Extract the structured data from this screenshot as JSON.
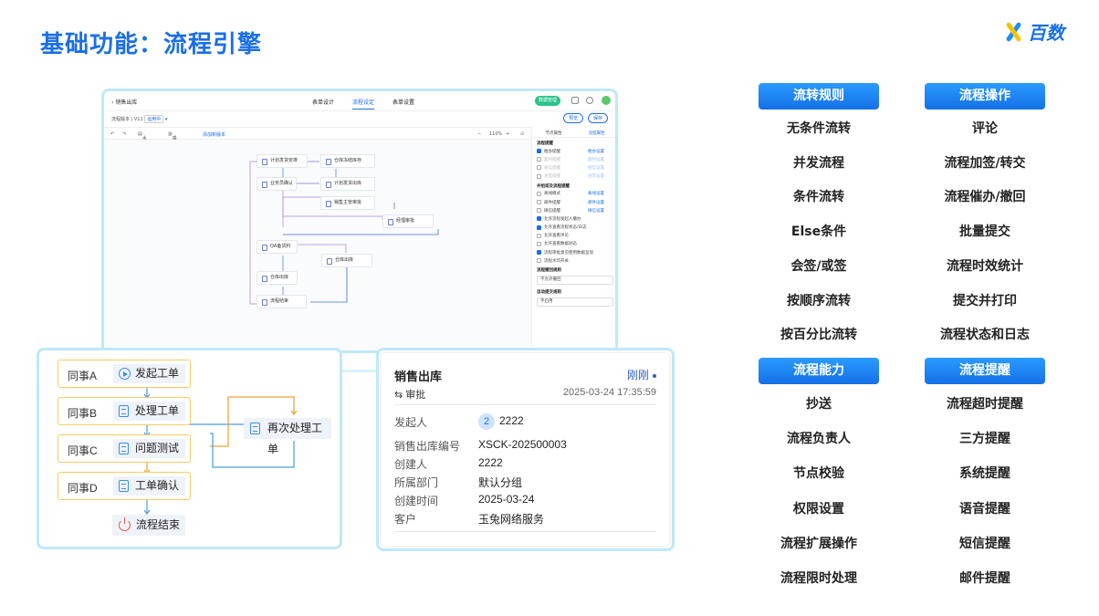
{
  "title": "基础功能：流程引擎",
  "logo_text": "百数",
  "screenshot": {
    "back_label": "销售出库",
    "tabs": [
      "表单设计",
      "流程设定",
      "表单设置"
    ],
    "active_tab": 1,
    "publish_label": "数据管理",
    "version_label": "流程版本 | V11",
    "version_tag": "运用中",
    "preview_label": "预览",
    "save_label": "保存",
    "toolbar": {
      "undo": "↶",
      "redo": "↷",
      "horizontal": "水平画面",
      "vertical": "垂直画面",
      "add_version": "添加新版本",
      "zoom": "110%"
    },
    "nodes": [
      "计划发货安排",
      "仓库冻结库存",
      "业务员确认",
      "计划发货出库",
      "销售主管审批",
      "经理审批",
      "QA备货料",
      "仓库出库",
      "仓库出库",
      "流程结束"
    ],
    "side_tabs": [
      "节点属性",
      "流程属性"
    ],
    "side_active": 1,
    "side": {
      "sec1": "流程提醒",
      "rows1": [
        {
          "label": "催办提醒",
          "link": "催办设置",
          "on": true
        },
        {
          "label": "超时提醒",
          "link": "超时设置",
          "on": false
        },
        {
          "label": "短信提醒",
          "link": "短信设置",
          "on": false
        },
        {
          "label": "语音提醒",
          "link": "语音设置",
          "on": false
        }
      ],
      "sec2": "并组或及流程提醒",
      "rows2": [
        {
          "label": "离线模式",
          "link": "离线设置",
          "on": false
        },
        {
          "label": "邮件提醒",
          "link": "邮件设置",
          "on": false
        },
        {
          "label": "微信提醒",
          "link": "微信设置",
          "on": false
        },
        {
          "label": "允许流程发起人撤办",
          "link": "",
          "on": true
        },
        {
          "label": "允许查看流程状态/日志",
          "link": "",
          "on": true
        },
        {
          "label": "允许查看评论",
          "link": "",
          "on": false
        },
        {
          "label": "允许查看数据动态",
          "link": "",
          "on": false
        },
        {
          "label": "流程审批意见使用数据呈现",
          "link": "",
          "on": true
        },
        {
          "label": "流程水印开关",
          "link": "",
          "on": false
        }
      ],
      "sec3": "流程撤回规则",
      "sel3": "不允许撤回",
      "sec4": "自动提交规则",
      "sel4": "不启用"
    }
  },
  "flow": {
    "rows": [
      {
        "who": "同事A",
        "action": "发起工单",
        "icon": "play-icon"
      },
      {
        "who": "同事B",
        "action": "处理工单",
        "icon": "doc-icon"
      },
      {
        "who": "同事C",
        "action": "问题测试",
        "icon": "doc-icon"
      },
      {
        "who": "同事D",
        "action": "工单确认",
        "icon": "doc-icon"
      }
    ],
    "redo": "再次处理工单",
    "end": "流程结束"
  },
  "detail": {
    "title": "销售出库",
    "time_label": "刚刚",
    "sub": "审批",
    "date": "2025-03-24 17:35:59",
    "fields": [
      {
        "k": "发起人",
        "v": "2222",
        "badge": "2"
      },
      {
        "k": "销售出库编号",
        "v": "XSCK-202500003"
      },
      {
        "k": "创建人",
        "v": "2222"
      },
      {
        "k": "所属部门",
        "v": "默认分组"
      },
      {
        "k": "创建时间",
        "v": "2025-03-24"
      },
      {
        "k": "客户",
        "v": "玉兔网络服务"
      }
    ]
  },
  "features": {
    "col1_top": {
      "title": "流转规则",
      "items": [
        "无条件流转",
        "并发流程",
        "条件流转",
        "Else条件",
        "会签/或签",
        "按顺序流转",
        "按百分比流转"
      ]
    },
    "col2_top": {
      "title": "流程操作",
      "items": [
        "评论",
        "流程加签/转交",
        "流程催办/撤回",
        "批量提交",
        "流程时效统计",
        "提交并打印",
        "流程状态和日志"
      ]
    },
    "col1_bot": {
      "title": "流程能力",
      "items": [
        "抄送",
        "流程负责人",
        "节点校验",
        "权限设置",
        "流程扩展操作",
        "流程限时处理"
      ]
    },
    "col2_bot": {
      "title": "流程提醒",
      "items": [
        "流程超时提醒",
        "三方提醒",
        "系统提醒",
        "语音提醒",
        "短信提醒",
        "邮件提醒"
      ]
    }
  },
  "colors": {
    "brand": "#1a6fe8",
    "accent": "#2a9bff",
    "yellow": "#f5cd5f",
    "orange": "#f0a030"
  }
}
